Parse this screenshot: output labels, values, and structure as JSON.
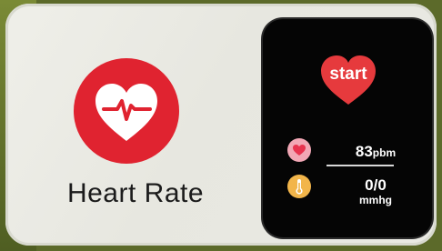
{
  "app": {
    "title": "Heart Rate",
    "icon": "heart-pulse-icon",
    "icon_color": "#e02330"
  },
  "watch": {
    "start_label": "start",
    "start_color": "#e63a3d",
    "heart_rate": {
      "icon": "heart-icon",
      "value": "83",
      "unit": "pbm"
    },
    "blood_pressure": {
      "icon": "thermometer-icon",
      "value": "0/0",
      "unit": "mmhg"
    }
  }
}
